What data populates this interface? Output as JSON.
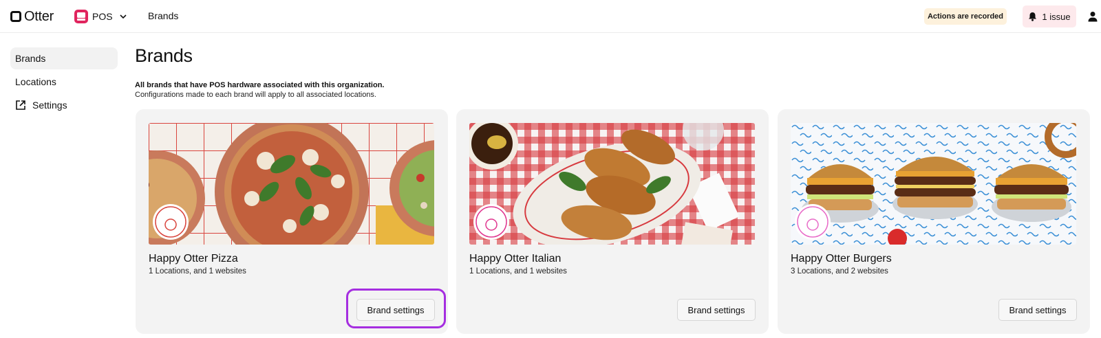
{
  "header": {
    "logo_text": "Otter",
    "product_label": "POS",
    "breadcrumb": "Brands",
    "recorded_badge": "Actions are recorded",
    "issues_label": "1 issue"
  },
  "sidebar": {
    "items": [
      {
        "label": "Brands",
        "active": true
      },
      {
        "label": "Locations",
        "active": false
      },
      {
        "label": "Settings",
        "active": false,
        "icon": "external-link-icon"
      }
    ]
  },
  "main": {
    "title": "Brands",
    "description_bold": "All brands that have POS hardware associated with this organization.",
    "description": "Configurations made to each brand will apply to all associated locations.",
    "brands": [
      {
        "name": "Happy Otter Pizza",
        "meta": "1 Locations, and 1 websites",
        "button": "Brand settings",
        "focused": true
      },
      {
        "name": "Happy Otter Italian",
        "meta": "1 Locations, and 1 websites",
        "button": "Brand settings",
        "focused": false
      },
      {
        "name": "Happy Otter Burgers",
        "meta": "3 Locations, and 2 websites",
        "button": "Brand settings",
        "focused": false
      }
    ]
  },
  "colors": {
    "pos_accent": "#e0245e",
    "focus_ring": "#a52ee0",
    "recorded_bg": "#fdf1dc",
    "issue_bg": "#fde9ec",
    "card_bg": "#f3f3f3"
  }
}
